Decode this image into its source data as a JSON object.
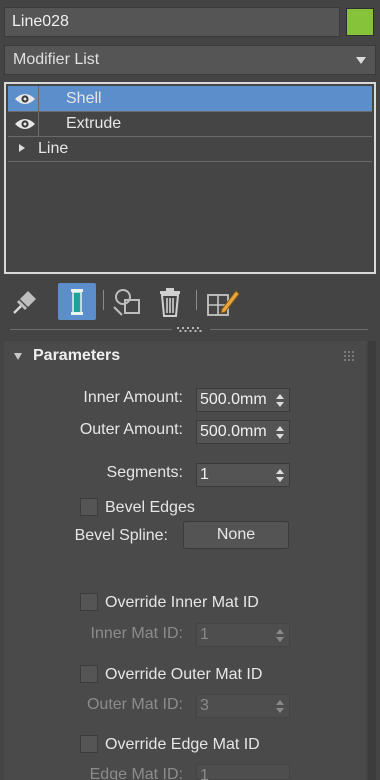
{
  "object": {
    "name": "Line028",
    "color": "#86c23a"
  },
  "modifier_list": {
    "label": "Modifier List"
  },
  "stack": {
    "items": [
      {
        "label": "Shell",
        "selected": true,
        "visible_icon": "eye-icon"
      },
      {
        "label": "Extrude",
        "selected": false,
        "visible_icon": "eye-icon"
      },
      {
        "label": "Line",
        "selected": false,
        "expand_icon": "triangle-right-icon"
      }
    ]
  },
  "toolbar": {
    "icons": [
      "pin-stack-icon",
      "show-end-result-icon",
      "make-unique-icon",
      "remove-modifier-icon",
      "configure-modifier-sets-icon"
    ],
    "active": "show-end-result-icon"
  },
  "rollout": {
    "title": "Parameters",
    "inner_amount": {
      "label": "Inner Amount:",
      "value": "500.0mm"
    },
    "outer_amount": {
      "label": "Outer Amount:",
      "value": "500.0mm"
    },
    "segments": {
      "label": "Segments:",
      "value": "1"
    },
    "bevel_edges": {
      "label": "Bevel Edges",
      "checked": false
    },
    "bevel_spline": {
      "label": "Bevel Spline:",
      "button": "None"
    },
    "override_inner": {
      "label": "Override Inner Mat ID",
      "checked": false
    },
    "inner_mat_id": {
      "label": "Inner Mat ID:",
      "value": "1",
      "enabled": false
    },
    "override_outer": {
      "label": "Override Outer Mat ID",
      "checked": false
    },
    "outer_mat_id": {
      "label": "Outer Mat ID:",
      "value": "3",
      "enabled": false
    },
    "override_edge": {
      "label": "Override Edge Mat ID",
      "checked": false
    },
    "edge_mat_id": {
      "label": "Edge Mat ID:",
      "value": "1",
      "enabled": false
    }
  },
  "colors": {
    "accent": "#5b8ecb",
    "background": "#444444"
  }
}
